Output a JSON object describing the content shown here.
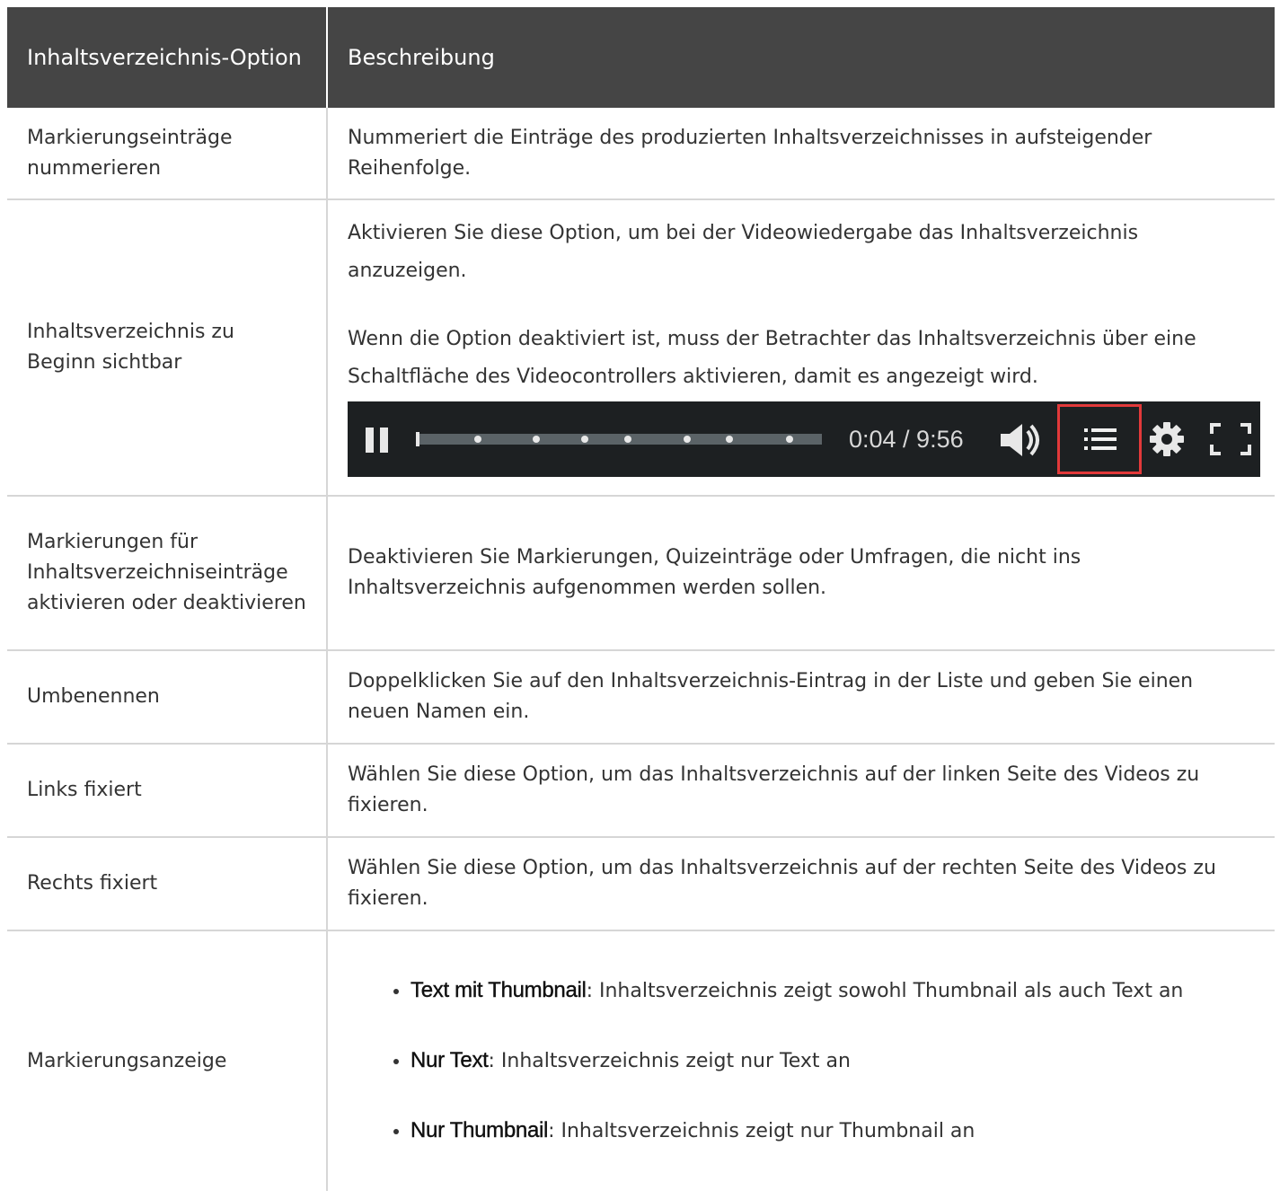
{
  "header": {
    "col1": "Inhaltsverzeichnis-Option",
    "col2": "Beschreibung"
  },
  "rows": [
    {
      "option": "Markierungseinträge nummerieren",
      "desc": "Nummeriert die Einträge des produzierten Inhaltsverzeichnisses in aufsteigender Reihenfolge."
    },
    {
      "option": "Inhaltsverzeichnis zu Beginn sichtbar",
      "desc1": "Aktivieren Sie diese Option, um bei der Videowiedergabe das Inhaltsverzeichnis anzuzeigen.",
      "desc2": "Wenn die Option deaktiviert ist, muss der Betrachter das Inhaltsverzeichnis über eine Schaltfläche des Videocontrollers aktivieren, damit es angezeigt wird."
    },
    {
      "option": "Markierungen für Inhaltsverzeichniseinträge aktivieren oder deaktivieren",
      "desc": "Deaktivieren Sie Markierungen, Quizeinträge oder Umfragen, die nicht ins Inhaltsverzeichnis aufgenommen werden sollen."
    },
    {
      "option": "Umbenennen",
      "desc": "Doppelklicken Sie auf den Inhaltsverzeichnis-Eintrag in der Liste und geben Sie einen neuen Namen ein."
    },
    {
      "option": "Links fixiert",
      "desc": "Wählen Sie diese Option, um das Inhaltsverzeichnis auf der linken Seite des Videos zu fixieren."
    },
    {
      "option": "Rechts fixiert",
      "desc": "Wählen Sie diese Option, um das Inhaltsverzeichnis auf der rechten Seite des Videos zu fixieren."
    },
    {
      "option": "Markierungsanzeige",
      "bullets": [
        {
          "term": "Text mit Thumbnail",
          "text": ": Inhaltsverzeichnis zeigt sowohl Thumbnail als auch Text an"
        },
        {
          "term": "Nur Text",
          "text": ": Inhaltsverzeichnis zeigt nur Text an"
        },
        {
          "term": "Nur Thumbnail",
          "text": ": Inhaltsverzeichnis zeigt nur Thumbnail an"
        }
      ]
    }
  ],
  "player": {
    "time": "0:04 / 9:56",
    "toc_highlight_color": "#e2393a",
    "icons": [
      "pause-icon",
      "volume-icon",
      "toc-list-icon",
      "gear-icon",
      "fullscreen-icon"
    ]
  }
}
